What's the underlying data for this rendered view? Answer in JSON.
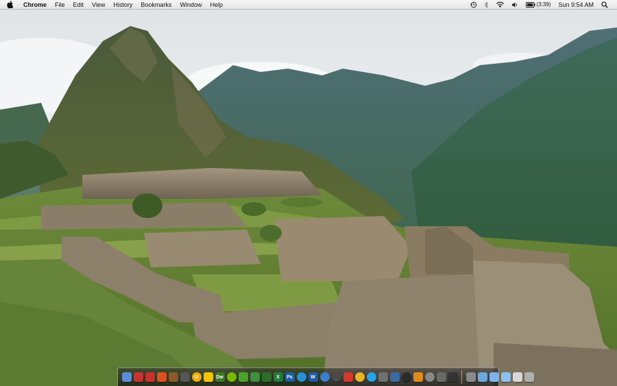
{
  "menubar": {
    "app_name": "Chrome",
    "items": [
      "File",
      "Edit",
      "View",
      "History",
      "Bookmarks",
      "Window",
      "Help"
    ],
    "battery_time": "(3:39)",
    "clock": "Sun 9:54 AM"
  },
  "status_icons": [
    "time-machine-icon",
    "bluetooth-icon",
    "wifi-icon",
    "volume-icon",
    "battery-icon",
    "spotlight-icon"
  ],
  "dock": {
    "apps": [
      {
        "icon": "finder-icon",
        "label": "",
        "color": "#5a8fd8"
      },
      {
        "icon": "pin-icon",
        "label": "",
        "color": "#c83232"
      },
      {
        "icon": "pdf-icon",
        "label": "",
        "color": "#c9302c"
      },
      {
        "icon": "uninstaller-icon",
        "label": "",
        "color": "#d9531e"
      },
      {
        "icon": "guitar-icon",
        "label": "",
        "color": "#8a5a2b"
      },
      {
        "icon": "star-icon",
        "label": "",
        "color": "#555555"
      },
      {
        "icon": "o-icon",
        "label": "O",
        "color": "#f2a900"
      },
      {
        "icon": "adium-duck-icon",
        "label": "",
        "color": "#f5c400"
      },
      {
        "icon": "dreamweaver-icon",
        "label": "Dw",
        "color": "#3d7a25"
      },
      {
        "icon": "spotify-icon",
        "label": "",
        "color": "#7ab800"
      },
      {
        "icon": "evernote-icon",
        "label": "",
        "color": "#4ca22c"
      },
      {
        "icon": "ribbon-icon",
        "label": "",
        "color": "#3e8e3e"
      },
      {
        "icon": "flag-icon",
        "label": "",
        "color": "#2c6e2c"
      },
      {
        "icon": "excel-icon",
        "label": "X",
        "color": "#1f7a3c"
      },
      {
        "icon": "photoshop-icon",
        "label": "Ps",
        "color": "#1b5fa5"
      },
      {
        "icon": "itunes-icon",
        "label": "",
        "color": "#2b8fd6"
      },
      {
        "icon": "word-icon",
        "label": "W",
        "color": "#1e5aa8"
      },
      {
        "icon": "safari-icon",
        "label": "",
        "color": "#3a7dc9"
      },
      {
        "icon": "pinwheel-icon",
        "label": "",
        "color": "#4a4a4a"
      },
      {
        "icon": "ical-icon",
        "label": "",
        "color": "#d33a2c"
      },
      {
        "icon": "chrome-icon",
        "label": "",
        "color": "#e9b42a"
      },
      {
        "icon": "skype-icon",
        "label": "",
        "color": "#25a3e3"
      },
      {
        "icon": "preview-icon",
        "label": "",
        "color": "#707070"
      },
      {
        "icon": "quill-icon",
        "label": "",
        "color": "#3a6aa0"
      },
      {
        "icon": "quicktime-icon",
        "label": "",
        "color": "#2a2a2a"
      },
      {
        "icon": "vlc-icon",
        "label": "",
        "color": "#e08a1e"
      },
      {
        "icon": "bulb-icon",
        "label": "",
        "color": "#888888"
      },
      {
        "icon": "film-icon",
        "label": "",
        "color": "#6a6a6a"
      },
      {
        "icon": "terminal-icon",
        "label": "",
        "color": "#333333"
      }
    ],
    "stacks": [
      {
        "icon": "library-icon",
        "color": "#8a8a8a"
      },
      {
        "icon": "applications-folder-icon",
        "color": "#6aa8e0"
      },
      {
        "icon": "documents-folder-icon",
        "color": "#7ab4e8"
      },
      {
        "icon": "downloads-folder-icon",
        "color": "#8cc0ee"
      },
      {
        "icon": "mail-icon",
        "color": "#d8d8d8"
      },
      {
        "icon": "trash-icon",
        "color": "#b0b0b0"
      }
    ]
  },
  "colors": {
    "menubar_text": "#111111",
    "sky": "#e9ecee",
    "mountain": "#3c5f3c",
    "stone": "#8e806a",
    "grass": "#6f8f3a"
  }
}
